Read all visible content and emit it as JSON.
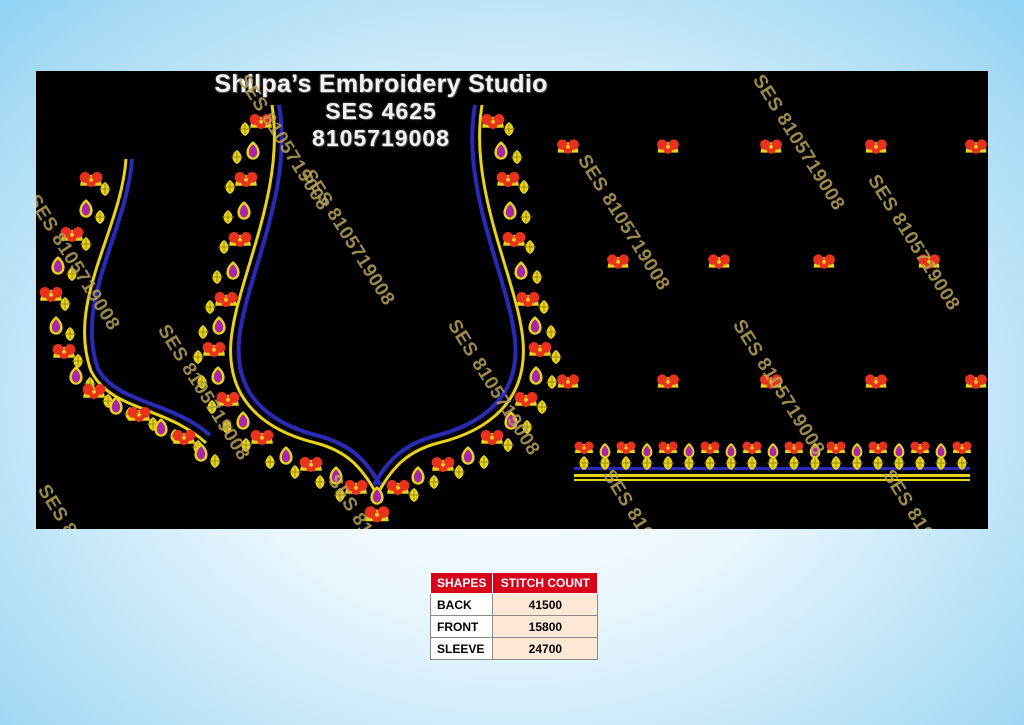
{
  "design": {
    "studio_name": "Shilpa’s Embroidery Studio",
    "code": "SES 4625",
    "phone": "8105719008",
    "watermark": "SES 8105719008"
  },
  "stitch_table": {
    "headers": [
      "SHAPES",
      "STITCH COUNT"
    ],
    "rows": [
      {
        "shape": "BACK",
        "count": "41500"
      },
      {
        "shape": "FRONT",
        "count": "15800"
      },
      {
        "shape": "SLEEVE",
        "count": "24700"
      }
    ]
  },
  "colors": {
    "panel": "#000000",
    "gold": "#e8d21a",
    "red": "#e8321e",
    "magenta": "#a826a8",
    "blue": "#2a2ab8",
    "header_red": "#d9001b"
  }
}
